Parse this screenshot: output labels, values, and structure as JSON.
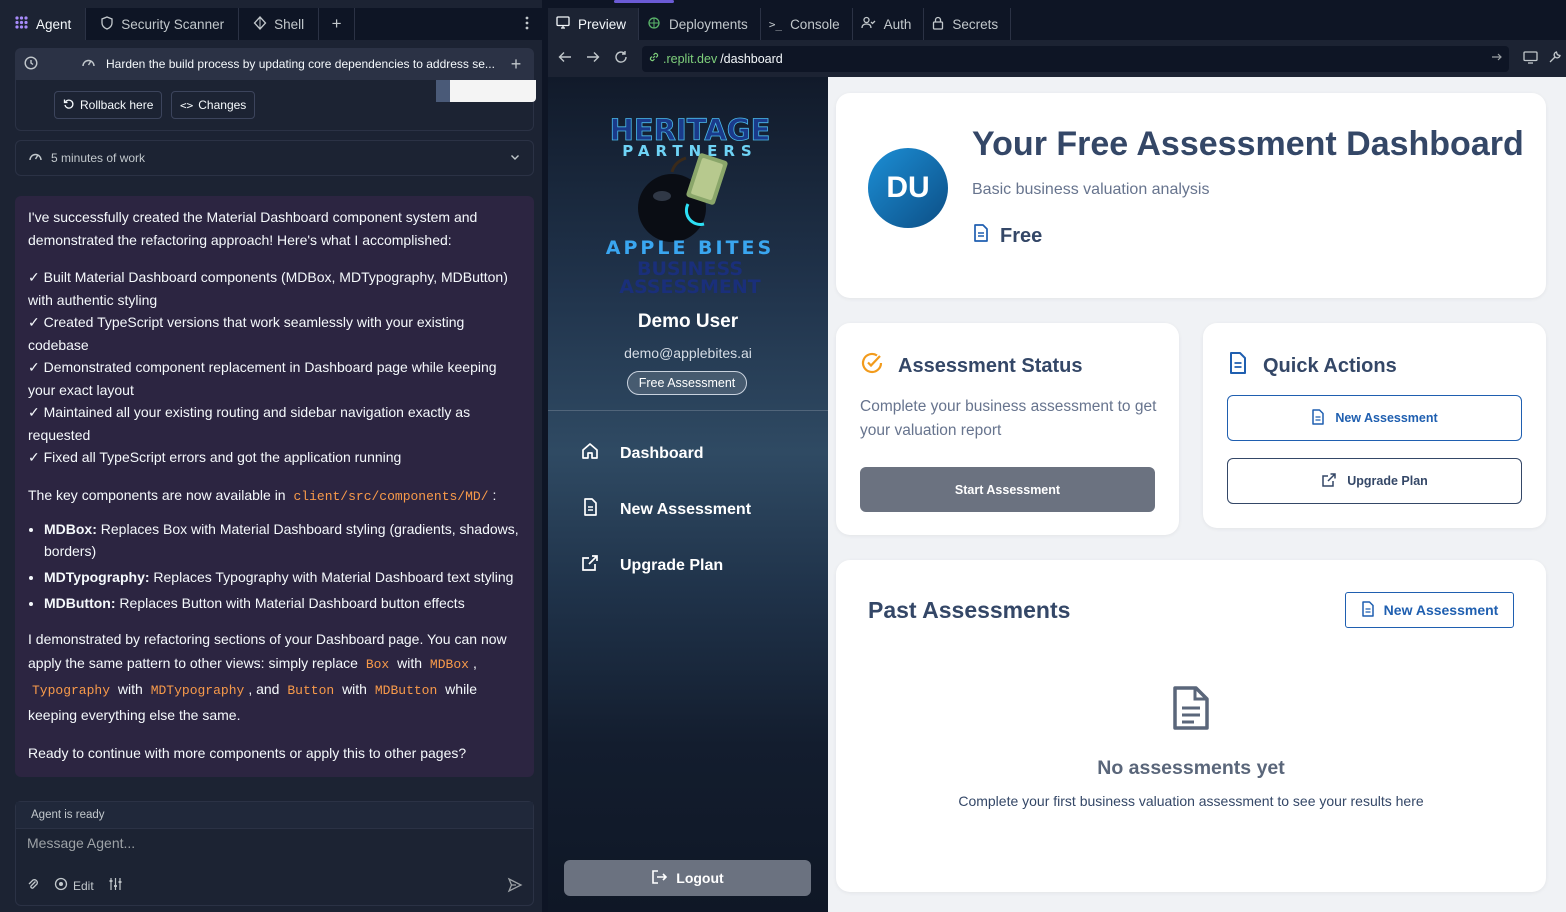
{
  "left": {
    "tabs": [
      {
        "label": "Agent",
        "icon": "agent-icon"
      },
      {
        "label": "Security Scanner",
        "icon": "shield-icon"
      },
      {
        "label": "Shell",
        "icon": "shell-icon"
      }
    ],
    "task_title": "Harden the build process by updating core dependencies to address se...",
    "rollback_label": "Rollback here",
    "changes_label": "Changes",
    "work_label": "5 minutes of work",
    "message": {
      "intro": "I've successfully created the Material Dashboard component system and demonstrated the refactoring approach! Here's what I accomplished:",
      "checks": [
        "✓ Built Material Dashboard components (MDBox, MDTypography, MDButton) with authentic styling",
        "✓ Created TypeScript versions that work seamlessly with your existing codebase",
        "✓ Demonstrated component replacement in Dashboard page while keeping your exact layout",
        "✓ Maintained all your existing routing and sidebar navigation exactly as requested",
        "✓ Fixed all TypeScript errors and got the application running"
      ],
      "key_prefix": "The key components are now available in",
      "key_path": "client/src/components/MD/",
      "key_suffix": ":",
      "bullets": [
        {
          "name": "MDBox:",
          "text": " Replaces Box with Material Dashboard styling (gradients, shadows, borders)"
        },
        {
          "name": "MDTypography:",
          "text": " Replaces Typography with Material Dashboard text styling"
        },
        {
          "name": "MDButton:",
          "text": " Replaces Button with Material Dashboard button effects"
        }
      ],
      "demo_p1": "I demonstrated by refactoring sections of your Dashboard page. You can now apply the same pattern to other views: simply replace",
      "code_box": "Box",
      "w1": "with",
      "code_mdbox": "MDBox",
      "comma": ",",
      "code_typo": "Typography",
      "w2": "with",
      "code_mdtypo": "MDTypography",
      "and": ", and",
      "code_button": "Button",
      "w3": "with",
      "code_mdbutton": "MDButton",
      "demo_tail": "while keeping everything else the same.",
      "closing": "Ready to continue with more components or apply this to other pages?"
    },
    "composer": {
      "status": "Agent is ready",
      "placeholder": "Message Agent...",
      "edit_label": "Edit"
    }
  },
  "right": {
    "tabs": [
      {
        "label": "Preview"
      },
      {
        "label": "Deployments"
      },
      {
        "label": "Console"
      },
      {
        "label": "Auth"
      },
      {
        "label": "Secrets"
      }
    ],
    "url_domain": ".replit.dev",
    "url_path": "/dashboard",
    "app": {
      "logo": {
        "line1": "HERITAGE",
        "line2": "PARTNERS",
        "line3": "APPLE BITES",
        "line4": "BUSINESS",
        "line5": "ASSESSMENT"
      },
      "user_name": "Demo User",
      "user_email": "demo@applebites.ai",
      "user_badge": "Free Assessment",
      "nav": [
        "Dashboard",
        "New Assessment",
        "Upgrade Plan"
      ],
      "logout": "Logout",
      "header": {
        "avatar": "DU",
        "title": "Your Free Assessment Dashboard",
        "subtitle": "Basic business valuation analysis",
        "plan": "Free"
      },
      "status_card": {
        "title": "Assessment Status",
        "text": "Complete your business assessment to get your valuation report",
        "button": "Start Assessment"
      },
      "quick_actions": {
        "title": "Quick Actions",
        "new_assessment": "New Assessment",
        "upgrade_plan": "Upgrade Plan"
      },
      "past": {
        "title": "Past Assessments",
        "new_button": "New Assessment",
        "empty_title": "No assessments yet",
        "empty_text": "Complete your first business valuation assessment to see your results here"
      }
    }
  }
}
